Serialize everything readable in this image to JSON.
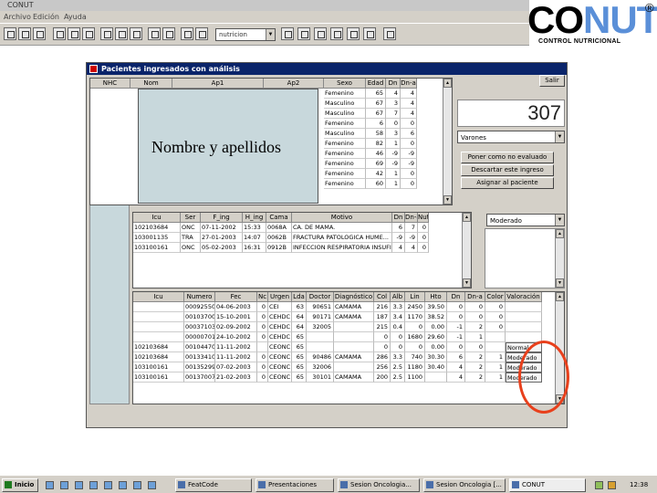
{
  "window": {
    "title": "CONUT"
  },
  "menu": [
    "Archivo",
    "Edición",
    "Ayuda"
  ],
  "toolbar": {
    "combo_value": "nutricion"
  },
  "logo": {
    "word_a": "CO",
    "word_b": "NUT",
    "reg": "®",
    "subtitle": "CONTROL NUTRICIONAL",
    "accent": "#5a8fd8"
  },
  "form": {
    "title": "Pacientes ingresados con análisis",
    "patients_grid": {
      "headers": [
        "NHC",
        "Nom",
        "Ap1",
        "Ap2",
        "Sexo",
        "Edad",
        "Dn",
        "Dn-a"
      ],
      "rows": [
        [
          "Femenino",
          "65",
          "4",
          "4"
        ],
        [
          "Masculino",
          "67",
          "3",
          "4"
        ],
        [
          "Masculino",
          "67",
          "7",
          "4"
        ],
        [
          "Femenino",
          "6",
          "0",
          "0"
        ],
        [
          "Masculino",
          "58",
          "3",
          "6"
        ],
        [
          "Femenino",
          "82",
          "1",
          "0"
        ],
        [
          "Femenino",
          "46",
          "-9",
          "-9"
        ],
        [
          "Femenino",
          "69",
          "-9",
          "-9"
        ],
        [
          "Femenino",
          "42",
          "1",
          "0"
        ],
        [
          "Femenino",
          "60",
          "1",
          "0"
        ]
      ]
    },
    "overlay_label": "Nombre y apellidos",
    "close_button": "Salir",
    "counter": "307",
    "service_dropdown": "Varones",
    "buttons": [
      "Poner como no evaluado",
      "Descartar este ingreso",
      "Asignar al paciente"
    ],
    "admissions_grid": {
      "headers": [
        "Icu",
        "Ser",
        "F_ing",
        "H_ing",
        "Cama",
        "Motivo",
        "Dn",
        "Dn-a",
        "Nut"
      ],
      "rows": [
        [
          "102103684",
          "ONC",
          "07-11-2002",
          "15:33",
          "0068A",
          "CA. DE MAMA.",
          "6",
          "7",
          "0"
        ],
        [
          "103001135",
          "TRA",
          "27-01-2003",
          "14:07",
          "0062B",
          "FRACTURA PATOLOGICA HUME...",
          "-9",
          "-9",
          "0"
        ],
        [
          "103100161",
          "ONC",
          "05-02-2003",
          "16:31",
          "0912B",
          "INFECCION RESPIRATORIA INSUFICIENCIA",
          "4",
          "4",
          "0"
        ]
      ]
    },
    "risk_dropdown": "Moderado",
    "analysis_grid": {
      "headers": [
        "Icu",
        "Numero",
        "Fec",
        "Nc",
        "Urgen",
        "Lda",
        "Doctor",
        "Diagnóstico",
        "Col",
        "Alb",
        "Lin",
        "Hto",
        "Dn",
        "Dn-a",
        "Color",
        "Valoración"
      ],
      "rows": [
        [
          "",
          "00092550",
          "04-06-2003",
          "0",
          "CEI",
          "63",
          "90651",
          "CAMAMA",
          "216",
          "3.3",
          "2450",
          "39.50",
          "0",
          "0",
          "0",
          ""
        ],
        [
          "",
          "00103700",
          "15-10-2001",
          "0",
          "CEHDC",
          "64",
          "90171",
          "CAMAMA",
          "187",
          "3.4",
          "1170",
          "38.52",
          "0",
          "0",
          "0",
          ""
        ],
        [
          "",
          "00037103",
          "02-09-2002",
          "0",
          "CEHDC",
          "64",
          "32005",
          "",
          "215",
          "0.4",
          "0",
          "0.00",
          "-1",
          "2",
          "0",
          ""
        ],
        [
          "",
          "00000701",
          "24-10-2002",
          "0",
          "CEHDC",
          "65",
          "",
          "",
          "0",
          "0",
          "1680",
          "29.60",
          "-1",
          "1",
          "",
          ""
        ],
        [
          "102103684",
          "00104470",
          "11-11-2002",
          "",
          "CEONC",
          "65",
          "",
          "",
          "0",
          "0",
          "0",
          "0.00",
          "0",
          "0",
          "",
          "Normal"
        ],
        [
          "102103684",
          "00133410",
          "11-11-2002",
          "0",
          "CEONC",
          "65",
          "90486",
          "CAMAMA",
          "286",
          "3.3",
          "740",
          "30.30",
          "6",
          "2",
          "1",
          "Moderado"
        ],
        [
          "103100161",
          "00135299",
          "07-02-2003",
          "0",
          "CEONC",
          "65",
          "32006",
          "",
          "256",
          "2.5",
          "1180",
          "30.40",
          "4",
          "2",
          "1",
          "Moderado"
        ],
        [
          "103100161",
          "00137007",
          "21-02-2003",
          "0",
          "CEONC",
          "65",
          "30101",
          "CAMAMA",
          "200",
          "2.5",
          "1100",
          "",
          "4",
          "2",
          "1",
          "Moderado"
        ]
      ]
    },
    "highlight_color": "#e8401c"
  },
  "taskbar": {
    "start": "Inicio",
    "tasks": [
      "FeatCode",
      "Presentaciones",
      "Sesion Oncologia...",
      "Sesion Oncologia [...",
      "CONUT"
    ],
    "clock": "12:38"
  }
}
